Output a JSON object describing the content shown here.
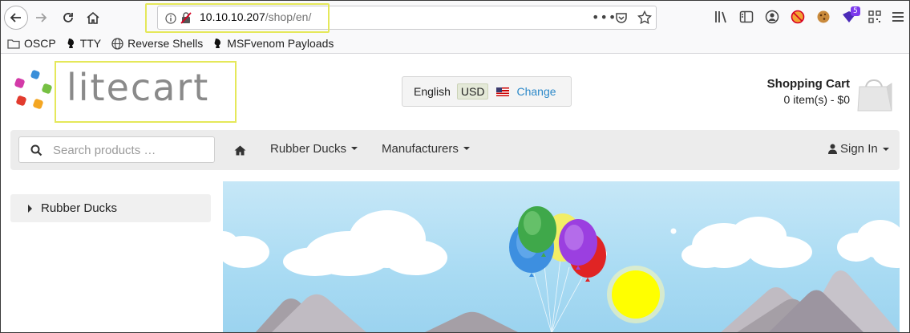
{
  "browser": {
    "url_host": "10.10.10.207",
    "url_path": "/shop/en/",
    "url_more": "•••",
    "extension_badge": "5",
    "bookmarks": [
      {
        "label": "OSCP",
        "icon": "folder-icon"
      },
      {
        "label": "TTY",
        "icon": "kali-icon"
      },
      {
        "label": "Reverse Shells",
        "icon": "globe-icon"
      },
      {
        "label": "MSFvenom Payloads",
        "icon": "kali-icon"
      }
    ]
  },
  "header": {
    "logo_text": "litecart",
    "language": "English",
    "currency": "USD",
    "change_label": "Change",
    "cart_title": "Shopping Cart",
    "cart_summary": "0 item(s) - $0"
  },
  "navbar": {
    "search_placeholder": "Search products …",
    "items": [
      {
        "label": "Rubber Ducks"
      },
      {
        "label": "Manufacturers"
      }
    ],
    "signin_label": "Sign In"
  },
  "sidebar": {
    "categories": [
      {
        "label": "Rubber Ducks"
      }
    ]
  },
  "colors": {
    "url_highlight": "#e5e85a",
    "link": "#2d89c9",
    "sky": "#a9dbf3",
    "sun": "#ffff00"
  }
}
